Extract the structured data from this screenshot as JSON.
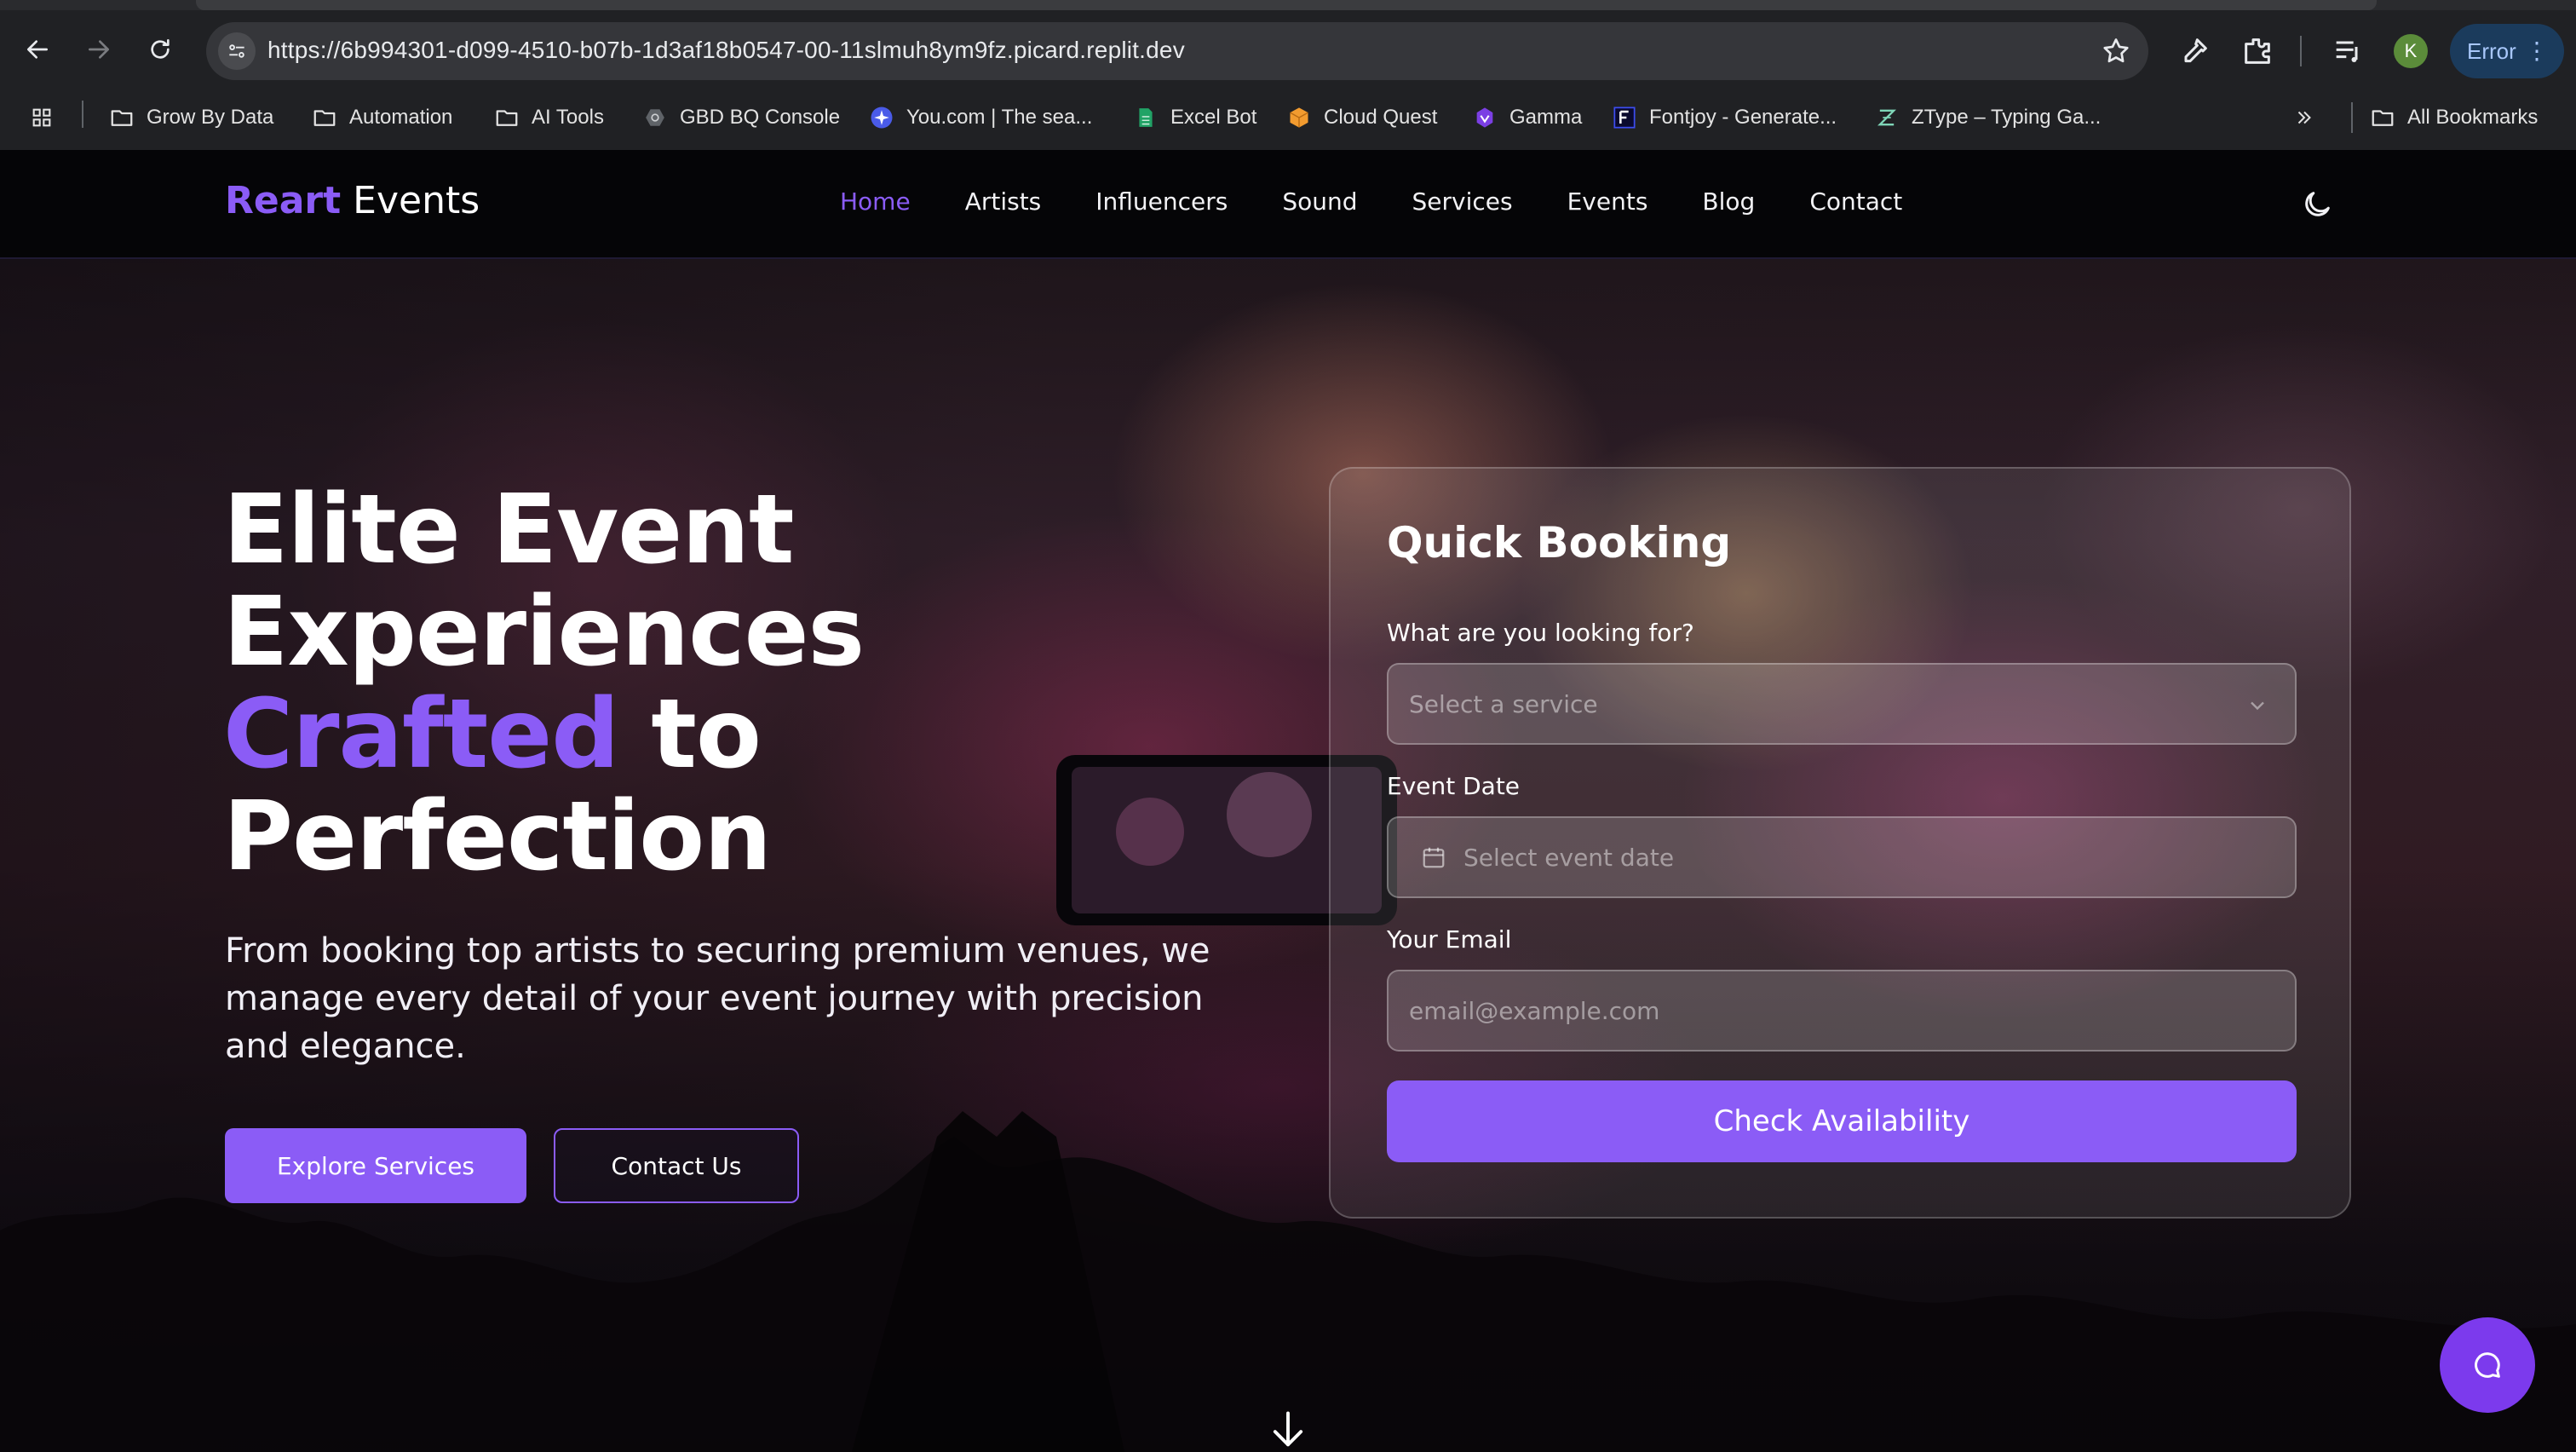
{
  "browser": {
    "url": "https://6b994301-d099-4510-b07b-1d3af18b0547-00-11slmuh8ym9fz.picard.replit.dev",
    "profile_initial": "K",
    "error_label": "Error",
    "bookmarks": [
      {
        "label": "Grow By Data",
        "icon": "folder-icon"
      },
      {
        "label": "Automation",
        "icon": "folder-icon"
      },
      {
        "label": "AI Tools",
        "icon": "folder-icon"
      },
      {
        "label": "GBD BQ Console",
        "icon": "bigquery-icon"
      },
      {
        "label": "You.com | The sea...",
        "icon": "youcom-icon"
      },
      {
        "label": "Excel Bot",
        "icon": "sheet-icon"
      },
      {
        "label": "Cloud Quest",
        "icon": "cube-icon"
      },
      {
        "label": "Gamma",
        "icon": "gamma-icon"
      },
      {
        "label": "Fontjoy - Generate...",
        "icon": "fontjoy-icon"
      },
      {
        "label": "ZType – Typing Ga...",
        "icon": "ztype-icon"
      }
    ],
    "all_bookmarks": "All Bookmarks"
  },
  "nav": {
    "brand": "Reart",
    "brand_suffix": "Events",
    "items": [
      "Home",
      "Artists",
      "Influencers",
      "Sound",
      "Services",
      "Events",
      "Blog",
      "Contact"
    ],
    "active": "Home"
  },
  "hero": {
    "title_line1": "Elite Event",
    "title_line2": "Experiences",
    "title_accent": "Crafted",
    "title_line3_rest": " to",
    "title_line4": "Perfection",
    "subtitle": "From booking top artists to securing premium venues, we manage every detail of your event journey with precision and elegance.",
    "primary_button": "Explore Services",
    "secondary_button": "Contact Us"
  },
  "booking": {
    "title": "Quick Booking",
    "service_label": "What are you looking for?",
    "service_placeholder": "Select a service",
    "date_label": "Event Date",
    "date_placeholder": "Select event date",
    "email_label": "Your Email",
    "email_placeholder": "email@example.com",
    "submit": "Check Availability"
  },
  "colors": {
    "accent": "#8b5cf6",
    "nav_bg": "#050507",
    "chat_fab": "#7c3aed"
  }
}
